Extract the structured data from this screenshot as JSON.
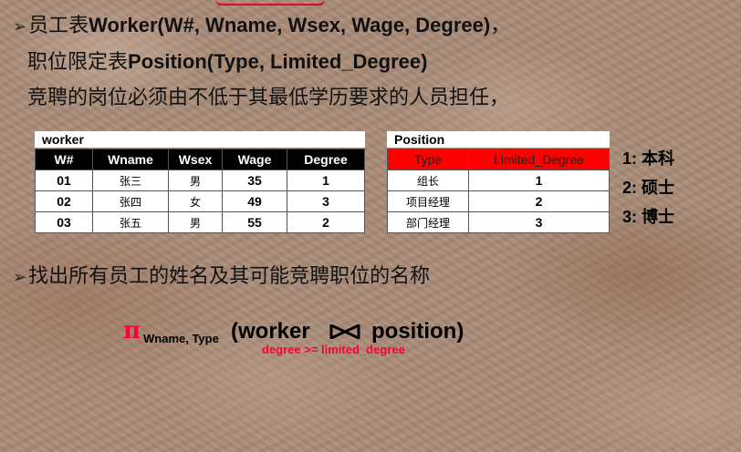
{
  "lines": {
    "worker_def_prefix": "员工表",
    "worker_def_bold": "Worker(W#, Wname, Wsex, Wage, Degree)",
    "worker_def_suffix": "，",
    "position_def_prefix": "职位限定表",
    "position_def_bold": "Position(Type, Limited_Degree)",
    "rule": "竞聘的岗位必须由不低于其最低学历要求的人员担任，",
    "question": "找出所有员工的姓名及其可能竞聘职位的名称"
  },
  "worker_table": {
    "title": "worker",
    "headers": [
      "W#",
      "Wname",
      "Wsex",
      "Wage",
      "Degree"
    ],
    "rows": [
      [
        "01",
        "张三",
        "男",
        "35",
        "1"
      ],
      [
        "02",
        "张四",
        "女",
        "49",
        "3"
      ],
      [
        "03",
        "张五",
        "男",
        "55",
        "2"
      ]
    ]
  },
  "position_table": {
    "title": "Position",
    "headers": [
      "Type",
      "Limited_Degree"
    ],
    "rows": [
      [
        "组长",
        "1"
      ],
      [
        "项目经理",
        "2"
      ],
      [
        "部门经理",
        "3"
      ]
    ]
  },
  "degree_key": [
    "1: 本科",
    "2: 硕士",
    "3: 博士"
  ],
  "formula": {
    "pi": "π",
    "projection": "Wname, Type",
    "left": "(worker",
    "right": "position)",
    "condition": "degree >= limited_degree"
  },
  "colors": {
    "accent_red": "#ff0000",
    "header_black": "#000000"
  }
}
